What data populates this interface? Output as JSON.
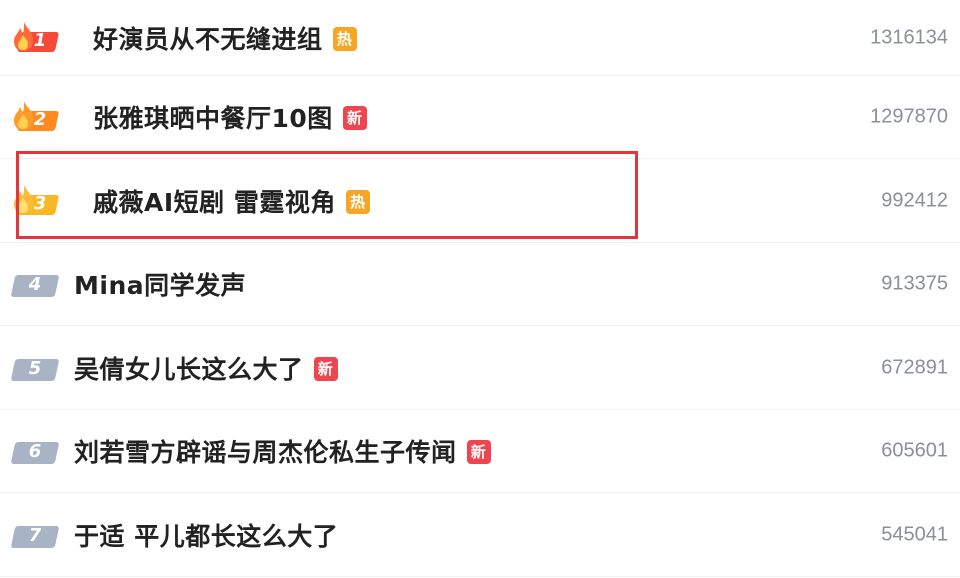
{
  "items": [
    {
      "rank": "1",
      "title": "好演员从不无缝进组",
      "badge": "热",
      "count": "1316134"
    },
    {
      "rank": "2",
      "title": "张雅琪晒中餐厅10图",
      "badge": "新",
      "count": "1297870"
    },
    {
      "rank": "3",
      "title": "戚薇AI短剧 雷霆视角",
      "badge": "热",
      "count": "992412"
    },
    {
      "rank": "4",
      "title": "Mina同学发声",
      "badge": "",
      "count": "913375"
    },
    {
      "rank": "5",
      "title": "吴倩女儿长这么大了",
      "badge": "新",
      "count": "672891"
    },
    {
      "rank": "6",
      "title": "刘若雪方辟谣与周杰伦私生子传闻",
      "badge": "新",
      "count": "605601"
    },
    {
      "rank": "7",
      "title": "于适 平儿都长这么大了",
      "badge": "",
      "count": "545041"
    }
  ],
  "colors": {
    "rank1": "#f44a3a",
    "rank2": "#ff8a1f",
    "rank3": "#f7b824",
    "rank_plain": "#a9b3c6",
    "badge_hot": "#f6a623",
    "badge_new": "#f0454f",
    "highlight": "#e4343c"
  },
  "icons": {
    "top_rank": "flame-icon"
  }
}
